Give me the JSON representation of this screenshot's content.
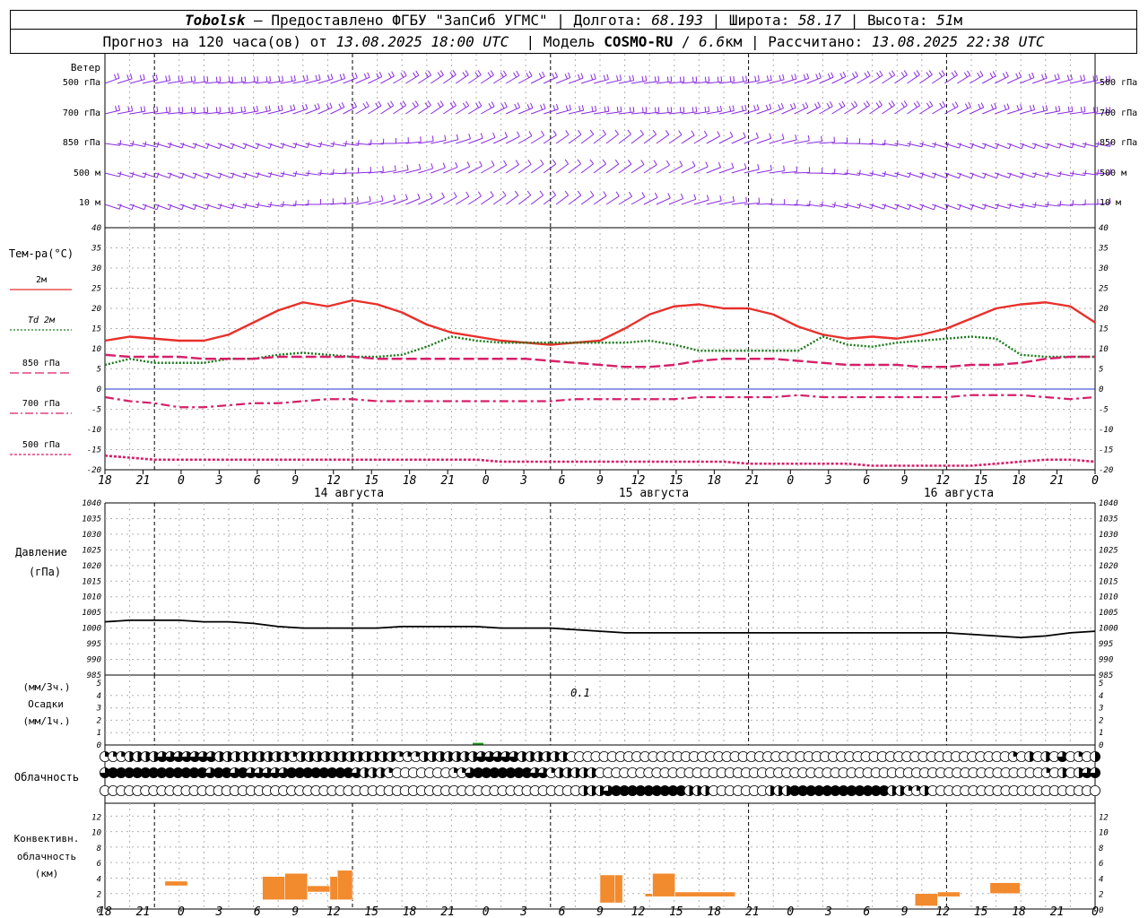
{
  "header": {
    "station": "Tobolsk",
    "dash": " — ",
    "provider": "Предоставлено ФГБУ \"ЗапСиб УГМС\"",
    "sep": " | ",
    "lon_label": "Долгота: ",
    "lon_value": "68.193",
    "lat_label": "Широта: ",
    "lat_value": "58.17",
    "alt_label": "Высота: ",
    "alt_value": "51",
    "alt_unit": "м"
  },
  "subheader": {
    "forecast_label": "Прогноз на 120 часа(ов) от ",
    "init_time": "13.08.2025 18:00 UTC",
    "model_label": "  | Модель ",
    "model_name": "COSMO-RU",
    "model_sep": " / ",
    "resolution_value": "6.6",
    "resolution_unit": "км",
    "calc_label": " | Рассчитано: ",
    "calc_time": "13.08.2025 22:38 UTC"
  },
  "time_axis": {
    "ticks": [
      "18",
      "21",
      "0",
      "3",
      "6",
      "9",
      "12",
      "15",
      "18",
      "21",
      "0",
      "3",
      "6",
      "9",
      "12",
      "15",
      "18",
      "21",
      "0",
      "3",
      "6",
      "9",
      "12",
      "15",
      "18",
      "21",
      "0"
    ],
    "dates": [
      "14 августа",
      "15 августа",
      "16 августа"
    ]
  },
  "wind_panel": {
    "title": "Ветер",
    "levels": [
      "500 гПа",
      "700 гПа",
      "850 гПа",
      "500 м",
      "10  м"
    ]
  },
  "temp_panel": {
    "title": "Тем-ра(°C)",
    "legend": [
      {
        "label": "2м",
        "color": "#e8302a",
        "style": "solid"
      },
      {
        "label": "Td  2м",
        "color": "#1a7a1a",
        "style": "dotted"
      },
      {
        "label": "850 гПа",
        "color": "#d61f69",
        "style": "dashed"
      },
      {
        "label": "700 гПа",
        "color": "#d61f69",
        "style": "dashdot"
      },
      {
        "label": "500 гПа",
        "color": "#d61f69",
        "style": "dense-dotted"
      }
    ],
    "yticks": [
      "40",
      "35",
      "30",
      "25",
      "20",
      "15",
      "10",
      "5",
      "0",
      "-5",
      "-10",
      "-15",
      "-20"
    ]
  },
  "pressure_panel": {
    "title1": "Давление",
    "title2": "(гПа)",
    "yticks": [
      "1040",
      "1035",
      "1030",
      "1025",
      "1020",
      "1015",
      "1010",
      "1005",
      "1000",
      "995",
      "990",
      "985"
    ]
  },
  "precip_panel": {
    "title1": "(мм/3ч.)",
    "title2": "Осадки",
    "title3": "(мм/1ч.)",
    "yticks": [
      "5",
      "4",
      "3",
      "2",
      "1",
      "0"
    ],
    "annotation": "0.1"
  },
  "cloud_panel": {
    "title": "Облачность"
  },
  "conv_panel": {
    "title1": "Конвективн.",
    "title2": "облачность",
    "title3": "(км)",
    "yticks": [
      "12",
      "10",
      "8",
      "6",
      "4",
      "2",
      "0"
    ],
    "bar_color": "#f28a2e"
  },
  "colors": {
    "wind": "#8a2be2",
    "grid": "#888888",
    "zero_line": "#2233cc",
    "pressure": "#000000",
    "precip": "#1a9a1a"
  },
  "chart_data": [
    {
      "type": "line",
      "title": "Тем-ра(°C)",
      "x_hours": [
        0,
        3,
        6,
        9,
        12,
        15,
        18,
        21,
        24,
        27,
        30,
        33,
        36,
        39,
        42,
        45,
        48,
        51,
        54,
        57,
        60,
        63,
        66,
        69,
        72,
        75,
        78,
        81,
        84,
        87,
        90,
        93,
        96,
        99,
        102,
        105,
        108,
        111,
        114,
        117,
        120
      ],
      "ylim": [
        -20,
        40
      ],
      "series": [
        {
          "name": "2м",
          "values": [
            12,
            13,
            12.5,
            12,
            12,
            13.5,
            16.5,
            19.5,
            21.5,
            20.5,
            22,
            21,
            19,
            16,
            14,
            13,
            12,
            11.5,
            11,
            11.5,
            12,
            15,
            18.5,
            20.5,
            21,
            20,
            20,
            18.5,
            15.5,
            13.5,
            12.5,
            13,
            12.5,
            13.5,
            15,
            17.5,
            20,
            21,
            21.5,
            20.5,
            16.5
          ]
        },
        {
          "name": "Td  2м",
          "values": [
            6,
            7.5,
            6.5,
            6.5,
            6.5,
            7.5,
            7.5,
            8.5,
            9,
            8.5,
            8,
            8,
            8.5,
            10.5,
            13,
            12,
            11.5,
            11.5,
            11.5,
            11.5,
            11.5,
            11.5,
            12,
            11,
            9.5,
            9.5,
            9.5,
            9.5,
            9.5,
            13,
            11,
            10.5,
            11.5,
            12,
            12.5,
            13,
            12.5,
            8.5,
            8,
            8,
            8
          ]
        },
        {
          "name": "850 гПа",
          "values": [
            8.5,
            8,
            8,
            8,
            7.5,
            7.5,
            7.5,
            8,
            8,
            8,
            8,
            7.5,
            7.5,
            7.5,
            7.5,
            7.5,
            7.5,
            7.5,
            7,
            6.5,
            6,
            5.5,
            5.5,
            6,
            7,
            7.5,
            7.5,
            7.5,
            7,
            6.5,
            6,
            6,
            6,
            5.5,
            5.5,
            6,
            6,
            6.5,
            7.5,
            8,
            8
          ]
        },
        {
          "name": "700 гПа",
          "values": [
            -2,
            -3,
            -3.5,
            -4.5,
            -4.5,
            -4,
            -3.5,
            -3.5,
            -3,
            -2.5,
            -2.5,
            -3,
            -3,
            -3,
            -3,
            -3,
            -3,
            -3,
            -3,
            -2.5,
            -2.5,
            -2.5,
            -2.5,
            -2.5,
            -2,
            -2,
            -2,
            -2,
            -1.5,
            -2,
            -2,
            -2,
            -2,
            -2,
            -2,
            -1.5,
            -1.5,
            -1.5,
            -2,
            -2.5,
            -2
          ]
        },
        {
          "name": "500 гПа",
          "values": [
            -16.5,
            -17,
            -17.5,
            -17.5,
            -17.5,
            -17.5,
            -17.5,
            -17.5,
            -17.5,
            -17.5,
            -17.5,
            -17.5,
            -17.5,
            -17.5,
            -17.5,
            -17.5,
            -18,
            -18,
            -18,
            -18,
            -18,
            -18,
            -18,
            -18,
            -18,
            -18,
            -18.5,
            -18.5,
            -18.5,
            -18.5,
            -18.5,
            -19,
            -19,
            -19,
            -19,
            -19,
            -18.5,
            -18,
            -17.5,
            -17.5,
            -18
          ]
        }
      ]
    },
    {
      "type": "line",
      "title": "Давление",
      "x_hours": [
        0,
        3,
        6,
        9,
        12,
        15,
        18,
        21,
        24,
        27,
        30,
        33,
        36,
        39,
        42,
        45,
        48,
        51,
        54,
        57,
        60,
        63,
        66,
        69,
        72,
        75,
        78,
        81,
        84,
        87,
        90,
        93,
        96,
        99,
        102,
        105,
        108,
        111,
        114,
        117,
        120
      ],
      "ylim": [
        985,
        1040
      ],
      "series": [
        {
          "name": "Давление",
          "values": [
            1002,
            1002.5,
            1002.5,
            1002.5,
            1002,
            1002,
            1001.5,
            1000.5,
            1000,
            1000,
            1000,
            1000,
            1000.5,
            1000.5,
            1000.5,
            1000.5,
            1000,
            1000,
            1000,
            999.5,
            999,
            998.5,
            998.5,
            998.5,
            998.5,
            998.5,
            998.5,
            998.5,
            998.5,
            998.5,
            998.5,
            998.5,
            998.5,
            998.5,
            998.5,
            998,
            997.5,
            997,
            997.5,
            998.5,
            999
          ]
        }
      ]
    },
    {
      "type": "bar",
      "title": "Осадки",
      "ylim": [
        0,
        5
      ],
      "series": [
        {
          "name": "Осадки",
          "bars": [
            {
              "x_hours": 45,
              "value": 0.1
            }
          ]
        }
      ]
    },
    {
      "type": "bar",
      "title": "Конвективн. облачность (км)",
      "ylim": [
        0,
        13
      ],
      "series": [
        {
          "name": "Конвективн. облачность",
          "bars": [
            {
              "x_start": 8,
              "x_end": 11,
              "base": 3,
              "top": 3.6
            },
            {
              "x_start": 21,
              "x_end": 24,
              "base": 1.2,
              "top": 4.2
            },
            {
              "x_start": 24,
              "x_end": 27,
              "base": 1.2,
              "top": 4.6
            },
            {
              "x_start": 27,
              "x_end": 30,
              "base": 2.2,
              "top": 3
            },
            {
              "x_start": 30,
              "x_end": 31,
              "base": 1.2,
              "top": 4.2
            },
            {
              "x_start": 31,
              "x_end": 33,
              "base": 1.2,
              "top": 5
            },
            {
              "x_start": 66,
              "x_end": 68,
              "base": 0.8,
              "top": 4.4
            },
            {
              "x_start": 68,
              "x_end": 69,
              "base": 0.8,
              "top": 4.4
            },
            {
              "x_start": 72,
              "x_end": 73,
              "base": 1.6,
              "top": 2
            },
            {
              "x_start": 73,
              "x_end": 76,
              "base": 1.6,
              "top": 4.6
            },
            {
              "x_start": 76,
              "x_end": 84,
              "base": 1.6,
              "top": 2.2
            },
            {
              "x_start": 108,
              "x_end": 111,
              "base": 0.4,
              "top": 2
            },
            {
              "x_start": 111,
              "x_end": 114,
              "base": 1.6,
              "top": 2.2
            },
            {
              "x_start": 118,
              "x_end": 122,
              "base": 2,
              "top": 3.4
            }
          ]
        }
      ]
    },
    {
      "type": "table",
      "title": "Облачность",
      "rows": [
        {
          "name": "upper",
          "values": [
            0.25,
            0.25,
            0.25,
            0.5,
            0.5,
            0.5,
            0.5,
            0.75,
            0.75,
            0.75,
            0.75,
            0.75,
            0.75,
            0.75,
            0.5,
            0.5,
            0.5,
            0.5,
            0.5,
            0.5,
            0.5,
            0.5,
            0.5,
            0.25,
            0.5,
            0.5,
            0.5,
            0.5,
            0.5,
            0.5,
            0.5,
            0.5,
            0.5,
            0.5,
            0.5,
            0.5,
            0.25,
            0.25,
            0.25,
            0.5,
            0.5,
            0.5,
            0.5,
            0.5,
            0.5,
            0.5,
            0.75,
            0.75,
            0.75,
            0.75,
            0.75,
            0.5,
            0.5,
            0.5,
            0.5,
            0.5,
            0.5,
            0,
            0,
            0,
            0,
            0,
            0,
            0,
            0,
            0,
            0,
            0,
            0,
            0,
            0,
            0,
            0,
            0,
            0,
            0,
            0,
            0,
            0,
            0,
            0,
            0,
            0,
            0,
            0,
            0,
            0,
            0,
            0,
            0,
            0,
            0,
            0,
            0,
            0,
            0,
            0,
            0,
            0,
            0,
            0,
            0,
            0,
            0,
            0,
            0,
            0,
            0,
            0,
            0,
            0,
            0.25,
            0,
            0.5,
            0,
            0.5,
            0,
            0.75,
            0,
            0.25,
            0,
            0.5
          ]
        },
        {
          "name": "middle",
          "values": [
            0.75,
            1,
            1,
            1,
            1,
            1,
            1,
            1,
            1,
            1,
            1,
            1,
            1,
            0.75,
            1,
            1,
            0.75,
            1,
            0.75,
            0.75,
            0.75,
            0.75,
            0.75,
            1,
            1,
            1,
            1,
            1,
            1,
            1,
            1,
            0.75,
            0.5,
            0.5,
            0.5,
            0.25,
            0,
            0,
            0,
            0,
            0,
            0,
            0,
            0.25,
            0.25,
            0.75,
            1,
            1,
            1,
            1,
            1,
            1,
            1,
            0.75,
            0.75,
            0.25,
            0.5,
            0.5,
            0.5,
            0.5,
            0.5,
            0,
            0,
            0,
            0,
            0,
            0,
            0,
            0,
            0,
            0,
            0,
            0,
            0,
            0,
            0,
            0,
            0,
            0,
            0,
            0,
            0,
            0,
            0,
            0,
            0,
            0,
            0,
            0,
            0,
            0,
            0,
            0,
            0,
            0,
            0,
            0,
            0,
            0,
            0,
            0,
            0,
            0,
            0,
            0,
            0,
            0,
            0,
            0,
            0,
            0,
            0,
            0,
            0,
            0,
            0,
            0.25,
            0,
            0.5,
            0,
            0.5,
            0.75,
            0.75
          ]
        },
        {
          "name": "lower",
          "values": [
            0,
            0,
            0,
            0,
            0,
            0,
            0,
            0,
            0,
            0,
            0,
            0,
            0,
            0,
            0,
            0,
            0,
            0,
            0,
            0,
            0,
            0,
            0,
            0,
            0,
            0,
            0,
            0,
            0,
            0,
            0,
            0,
            0,
            0,
            0,
            0,
            0,
            0,
            0,
            0,
            0,
            0,
            0,
            0,
            0,
            0,
            0,
            0,
            0,
            0,
            0,
            0,
            0,
            0,
            0,
            0,
            0,
            0,
            0,
            0.5,
            0.5,
            0.5,
            0.75,
            1,
            1,
            1,
            1,
            1,
            1,
            1,
            1,
            1,
            0.5,
            0.5,
            0.5,
            0,
            0,
            0,
            0,
            0,
            0,
            0,
            0.5,
            0.5,
            0.5,
            1,
            1,
            1,
            1,
            1,
            1,
            1,
            1,
            1,
            1,
            1,
            1,
            0.5,
            0.5,
            0.25,
            0.25,
            0.5,
            0,
            0,
            0,
            0,
            0,
            0,
            0,
            0,
            0,
            0,
            0,
            0,
            0,
            0,
            0,
            0,
            0,
            0,
            0,
            0,
            0
          ]
        }
      ]
    }
  ]
}
